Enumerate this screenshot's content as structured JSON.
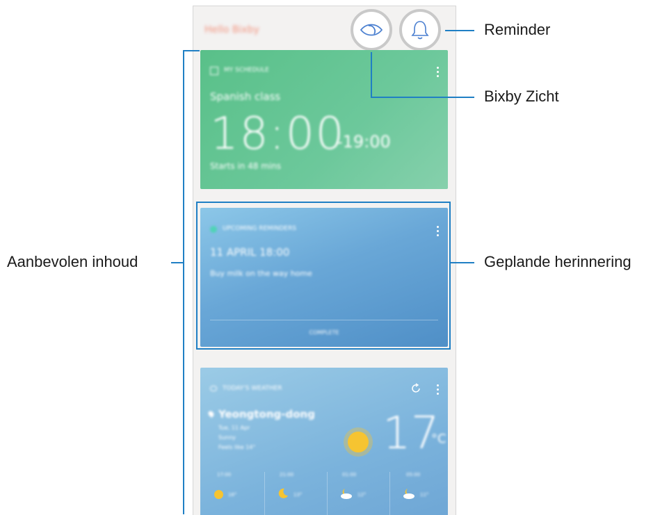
{
  "header": {
    "title": "Hello Bixby"
  },
  "icons": {
    "bixby_vision": "eye-icon",
    "reminder": "bell-icon"
  },
  "cards": {
    "schedule": {
      "label": "MY SCHEDULE",
      "event": "Spanish class",
      "time": "18:00",
      "end": "-19:00",
      "note": "Starts in 48 mins"
    },
    "reminder": {
      "label": "UPCOMING REMINDERS",
      "datetime": "11 APRIL 18:00",
      "text": "Buy milk on the way home",
      "action": "COMPLETE"
    },
    "weather": {
      "label": "TODAY'S WEATHER",
      "location": "Yeongtong-dong",
      "line1": "Tue, 11 Apr",
      "line2": "Sunny",
      "line3": "Feels like 14°",
      "temp": "17",
      "unit": "°C",
      "forecast": [
        {
          "time": "17:00",
          "temp": "16°"
        },
        {
          "time": "21:00",
          "temp": "13°"
        },
        {
          "time": "01:00",
          "temp": "12°"
        },
        {
          "time": "05:00",
          "temp": "11°"
        }
      ]
    }
  },
  "callouts": {
    "reminder": "Reminder",
    "bixby_vision": "Bixby Zicht",
    "recommended": "Aanbevolen inhoud",
    "planned": "Geplande herinnering"
  },
  "colors": {
    "callout_line": "#1f7fc4",
    "schedule_card": "#5fc292",
    "reminder_card": "#6aa8d8",
    "weather_card": "#86bde2"
  }
}
